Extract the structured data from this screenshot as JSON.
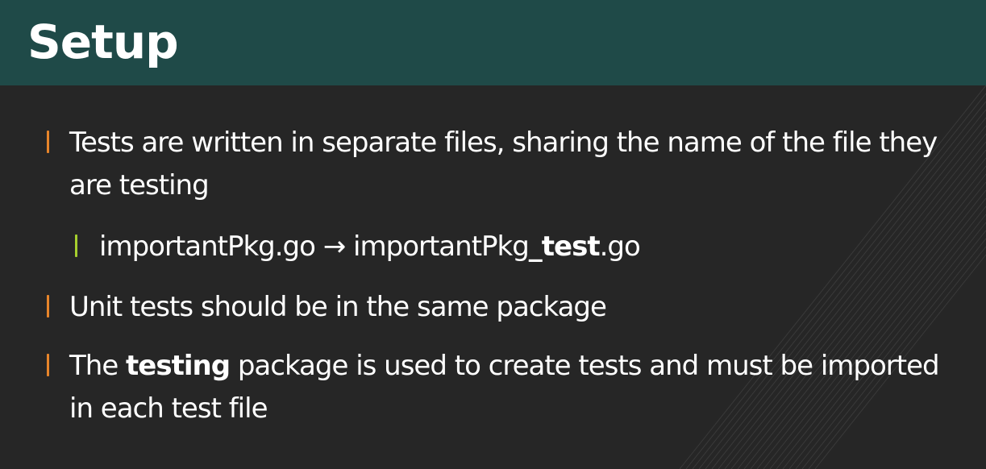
{
  "slide": {
    "title": "Setup"
  },
  "bullets": [
    {
      "text": "Tests are written in separate files, sharing the name of the file they are testing"
    },
    {
      "part1": "importantPkg.go → importantPkg",
      "bold": "_test",
      "part2": ".go"
    },
    {
      "text": "Unit tests should be in the same package"
    },
    {
      "part1": "The ",
      "bold": "testing",
      "part2": " package is used to create tests and must be imported in each test file"
    }
  ],
  "colors": {
    "header_bg": "#1f4a48",
    "slide_bg": "#262626",
    "bullet_primary": "#e8852a",
    "bullet_secondary": "#a6cf2e",
    "text": "#ffffff"
  }
}
